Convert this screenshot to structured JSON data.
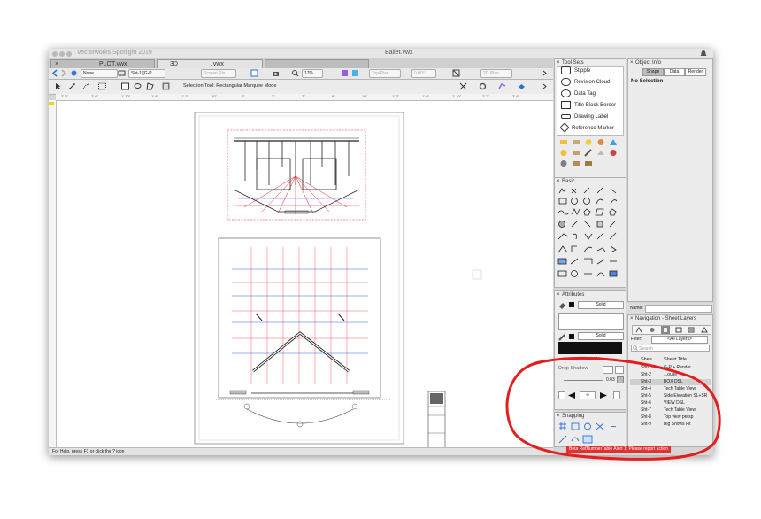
{
  "window": {
    "app_title": "Vectorworks Spotlight 2019",
    "doc_title": "Ballet.vwx"
  },
  "tabs": [
    {
      "label": "PLOT.vwx"
    },
    {
      "label": "3D"
    },
    {
      "label": ".vwx"
    }
  ],
  "toolbar1": {
    "class_value": "None",
    "layer_value": "Sht-1 [G-P...",
    "screen_plane": "Screen Pla...",
    "zoom": "17%",
    "top_plan": "Top/Plan",
    "angle": "0.00°",
    "view_2d": "2D Plan"
  },
  "toolbar2": {
    "mode_text": "Selection Tool: Rectangular Marquee Mode"
  },
  "ruler": {
    "top_ticks": [
      "2'-2\"",
      "2'-6\"",
      "1'-10\"",
      "1'-6\"",
      "1'-2\"",
      "10\"",
      "6\"",
      "2\"",
      "2\"",
      "6\"",
      "10\"",
      "1'-2\"",
      "1'-6\"",
      "1'-10\"",
      "2'-2\"",
      "2'-6\""
    ],
    "left_ticks": [
      "1'-8\"",
      "1'-4\"",
      "1'-0\"",
      "8\"",
      "4\"",
      "0\"",
      "4\"",
      "8\"",
      "1'-0\"",
      "1'-4\"",
      "1'-8\""
    ]
  },
  "status": {
    "text": "For Help, press F1 or click the ? icon"
  },
  "tool_sets": {
    "title": "Tool Sets",
    "items": [
      {
        "label": "Stipple",
        "icon": "stipple-icon"
      },
      {
        "label": "Revision Cloud",
        "icon": "cloud-icon"
      },
      {
        "label": "Data Tag",
        "icon": "data-tag-icon"
      },
      {
        "label": "Title Block Border",
        "icon": "title-block-icon"
      },
      {
        "label": "Drawing Label",
        "icon": "drawing-label-icon"
      },
      {
        "label": "Reference Marker",
        "icon": "reference-marker-icon"
      }
    ]
  },
  "basic": {
    "title": "Basic"
  },
  "attributes": {
    "title": "Attributes",
    "fill_style": "Solid",
    "pen_style": "Solid",
    "opacity": "100%/100%",
    "drop_shadow": "Drop Shadow",
    "line_weight": "0.03"
  },
  "snapping": {
    "title": "Snapping"
  },
  "object_info": {
    "title": "Object Info",
    "tabs": [
      "Shape",
      "Data",
      "Render"
    ],
    "selection": "No Selection"
  },
  "name_field": {
    "label": "Name:"
  },
  "navigation": {
    "title": "Navigation - Sheet Layers",
    "filter_label": "Filter:",
    "filter_value": "<All Layers>",
    "search_placeholder": "Search",
    "col_sheet": "Shee...",
    "col_title": "Sheet Title",
    "rows": [
      {
        "num": "Sht-1",
        "title": "G-P + Render"
      },
      {
        "num": "Sht-2",
        "title": "...ouse"
      },
      {
        "num": "Sht-3",
        "title": "BOX DSL"
      },
      {
        "num": "Sht-4",
        "title": "Tech Table View"
      },
      {
        "num": "Sht-5",
        "title": "Side Elevation SL+SR"
      },
      {
        "num": "Sht-6",
        "title": "VIEW DSL"
      },
      {
        "num": "Sht-7",
        "title": "Tech Table View"
      },
      {
        "num": "Sht-8",
        "title": "Top view persp"
      },
      {
        "num": "Sht-9",
        "title": "Big Shows Fit"
      }
    ]
  },
  "alert": {
    "text": "Beta RefNumberTable Alert 1: Please report action"
  },
  "colors": {
    "annotation_red": "#e41e1e",
    "selection_blue": "#2f6fdc",
    "alert_red": "#e03030"
  }
}
